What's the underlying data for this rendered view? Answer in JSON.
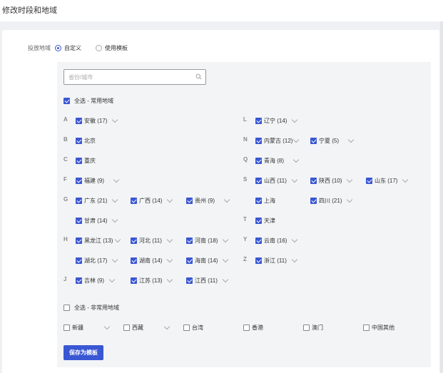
{
  "page": {
    "title": "修改时段和地域"
  },
  "region": {
    "label": "投放地域",
    "options": [
      {
        "label": "自定义",
        "selected": true
      },
      {
        "label": "使用模板",
        "selected": false
      }
    ]
  },
  "search": {
    "placeholder": "省份/城市",
    "value": ""
  },
  "common": {
    "select_all_label": "全选 - 常用地域",
    "checked": true,
    "groups": {
      "A": "A",
      "B": "B",
      "C": "C",
      "F": "F",
      "G": "G",
      "H": "H",
      "J": "J",
      "L": "L",
      "N": "N",
      "Q": "Q",
      "S": "S",
      "T": "T",
      "Y": "Y",
      "Z": "Z"
    },
    "provinces": {
      "anhui": "安徽 (17)",
      "beijing": "北京",
      "chongqing": "重庆",
      "fujian": "福建 (9)",
      "guangdong": "广东 (21)",
      "guangxi": "广西 (14)",
      "guizhou": "贵州 (9)",
      "gansu": "甘肃 (14)",
      "heilongjiang": "黑龙江 (13)",
      "hebei": "河北 (11)",
      "henan": "河南 (18)",
      "hubei": "湖北 (17)",
      "hunan": "湖南 (14)",
      "hainan": "海南 (14)",
      "jilin": "吉林 (9)",
      "jiangsu": "江苏 (13)",
      "jiangxi": "江西 (11)",
      "liaoning": "辽宁 (14)",
      "neimenggu": "内蒙古 (12)",
      "ningxia": "宁夏 (5)",
      "qinghai": "青海 (8)",
      "shanxi": "山西 (11)",
      "shaanxi": "陕西 (10)",
      "shandong": "山东 (17)",
      "shanghai": "上海",
      "sichuan": "四川 (21)",
      "tianjin": "天津",
      "yunnan": "云南 (16)",
      "zhejiang": "浙江 (11)"
    }
  },
  "uncommon": {
    "select_all_label": "全选 - 非常用地域",
    "checked": false,
    "provinces": {
      "xinjiang": "新疆",
      "xizang": "西藏",
      "taiwan": "台湾",
      "hongkong": "香港",
      "macau": "澳门",
      "other": "中国其他"
    }
  },
  "actions": {
    "save_template": "保存为模板"
  },
  "colors": {
    "accent": "#3a57d3",
    "panel_bg": "#f3f4f6",
    "page_bg": "#eef0f4"
  }
}
